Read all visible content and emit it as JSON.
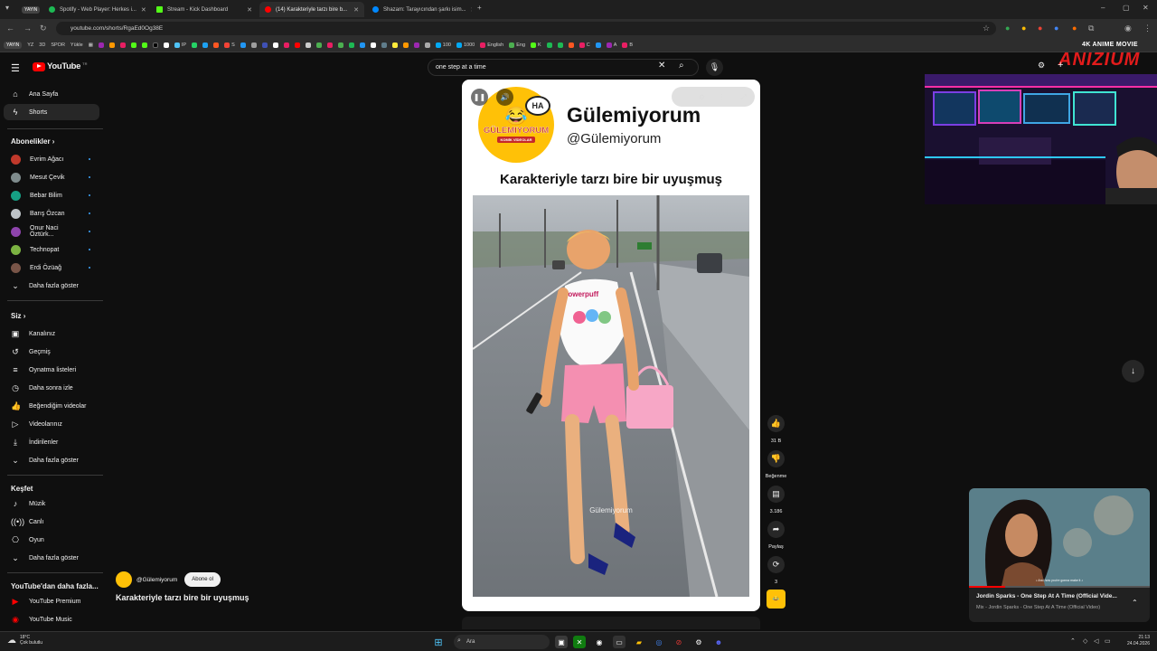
{
  "browser": {
    "tabs": [
      {
        "badge": "YAYIN",
        "label": ""
      },
      {
        "label": "Spotify - Web Player: Herkes i...",
        "color": "#1db954"
      },
      {
        "label": "Stream - Kick Dashboard",
        "color": "#53fc18"
      },
      {
        "label": "(14) Karakteriyle tarzı bire b...",
        "color": "#ff0000"
      },
      {
        "label": "Shazam: Tarayıcından şarkı isim...",
        "color": "#0088ff"
      }
    ],
    "url": "youtube.com/shorts/RgaEd0Og38E",
    "bookmarks": [
      "YAYIN",
      "YZ",
      "3D",
      "SPOR",
      "Yükle",
      "IP",
      "S",
      "100",
      "1000",
      "English",
      "Eng",
      "K",
      "C",
      "A",
      "B"
    ]
  },
  "header": {
    "logo_text": "YouTube",
    "logo_region": "TR",
    "search_value": "one step at a time"
  },
  "sidebar": {
    "main": [
      {
        "label": "Ana Sayfa",
        "icon": "home-icon"
      },
      {
        "label": "Shorts",
        "icon": "shorts-icon"
      }
    ],
    "subs_heading": "Abonelikler",
    "subscriptions": [
      {
        "label": "Evrim Ağacı",
        "color": "#c0392b"
      },
      {
        "label": "Mesut Çevik",
        "color": "#7f8c8d"
      },
      {
        "label": "Bebar Bilim",
        "color": "#16a085"
      },
      {
        "label": "Barış Özcan",
        "color": "#bdc3c7"
      },
      {
        "label": "Onur Naci Öztürk...",
        "color": "#8e44ad"
      },
      {
        "label": "Technopat",
        "color": "#7cb342"
      },
      {
        "label": "Erdi Özüağ",
        "color": "#795548"
      }
    ],
    "subs_more": "Daha fazla göster",
    "you_heading": "Siz",
    "you": [
      {
        "label": "Kanalınız",
        "icon": "channel-icon"
      },
      {
        "label": "Geçmiş",
        "icon": "history-icon"
      },
      {
        "label": "Oynatma listeleri",
        "icon": "playlist-icon"
      },
      {
        "label": "Daha sonra izle",
        "icon": "watch-later-icon"
      },
      {
        "label": "Beğendiğim videolar",
        "icon": "like-icon"
      },
      {
        "label": "Videolarınız",
        "icon": "your-videos-icon"
      },
      {
        "label": "İndirilenler",
        "icon": "download-icon"
      },
      {
        "label": "Daha fazla göster",
        "icon": "chevron-down-icon"
      }
    ],
    "explore_heading": "Keşfet",
    "explore": [
      {
        "label": "Müzik",
        "icon": "music-icon"
      },
      {
        "label": "Canlı",
        "icon": "live-icon"
      },
      {
        "label": "Oyun",
        "icon": "gaming-icon"
      },
      {
        "label": "Daha fazla göster",
        "icon": "chevron-down-icon"
      }
    ],
    "more_heading": "YouTube'dan daha fazla...",
    "more": [
      {
        "label": "YouTube Premium"
      },
      {
        "label": "YouTube Music"
      }
    ]
  },
  "short": {
    "logo_emoji": "😂",
    "logo_brand": "GÜLEMIYORUM",
    "logo_sub": "KOMİK VİDEOLAR",
    "bubble": "HA",
    "channel_title": "Gülemiyorum",
    "channel_handle": "@Gülemiyorum",
    "caption": "Karakteriyle tarzı bire bir uyuşmuş",
    "watermark": "Gülemiyorum",
    "shirt_text": "Powerpuff"
  },
  "actions": {
    "likes": "31 B",
    "dislike_label": "Beğenme",
    "comments": "3.186",
    "share_label": "Paylaş",
    "remix_count": "3"
  },
  "channel_row": {
    "name": "@Gülemiyorum",
    "subscribe": "Abone ol",
    "caption": "Karakteriyle tarzı bire bir uyuşmuş"
  },
  "overlay": {
    "logo_small": "4K ANIME MOVIE",
    "logo_big": "ANIZIUM"
  },
  "miniplayer": {
    "subtitle": "♪ And how you're gonna make it ♪",
    "title": "Jordin Sparks - One Step At A Time (Official Vide...",
    "meta": "Mix - Jordin Sparks - One Step At A Time (Official Video)",
    "progress": 0.2
  },
  "taskbar": {
    "temp": "18°C",
    "weather": "Çok bulutlu",
    "search": "Ara",
    "time": "21:13",
    "date": "24.04.2026"
  }
}
